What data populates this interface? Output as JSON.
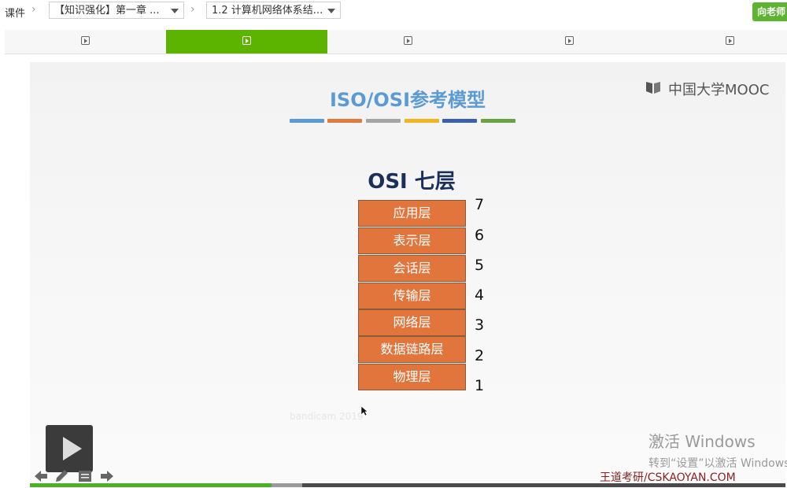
{
  "breadcrumb": {
    "root": "课件",
    "chapter": "【知识强化】第一章 ...",
    "lesson": "1.2 计算机网络体系结..."
  },
  "top_button": "向老师",
  "tabs": [
    {
      "icon": "video-icon",
      "active": false
    },
    {
      "icon": "video-icon",
      "active": true
    },
    {
      "icon": "video-icon",
      "active": false
    },
    {
      "icon": "video-icon",
      "active": false
    },
    {
      "icon": "video-icon",
      "active": false
    }
  ],
  "slide": {
    "title": "ISO/OSI参考模型",
    "title_bar_colors": [
      "#5b9bd5",
      "#e07a3f",
      "#a5a5a5",
      "#f0b51e",
      "#3b60b0",
      "#6aa343"
    ],
    "logo_text": "中国大学MOOC",
    "osi_heading": "OSI  七层",
    "layers": [
      {
        "name": "应用层",
        "number": "7"
      },
      {
        "name": "表示层",
        "number": "6"
      },
      {
        "name": "会话层",
        "number": "5"
      },
      {
        "name": "传输层",
        "number": "4"
      },
      {
        "name": "网络层",
        "number": "3"
      },
      {
        "name": "数据链路层",
        "number": "2"
      },
      {
        "name": "物理层",
        "number": "1"
      }
    ],
    "faint_watermark": "bandicam 2019",
    "activate_windows": {
      "line1": "激活 Windows",
      "line2": "转到“设置”以激活 Windows。"
    },
    "brand_watermark": "王道考研/CSKAOYAN.COM"
  },
  "player": {
    "progress_fraction": 0.32,
    "buffer_fraction": 0.36,
    "controls": [
      "prev-arrow-icon",
      "pencil-icon",
      "notes-icon",
      "next-arrow-icon"
    ]
  }
}
